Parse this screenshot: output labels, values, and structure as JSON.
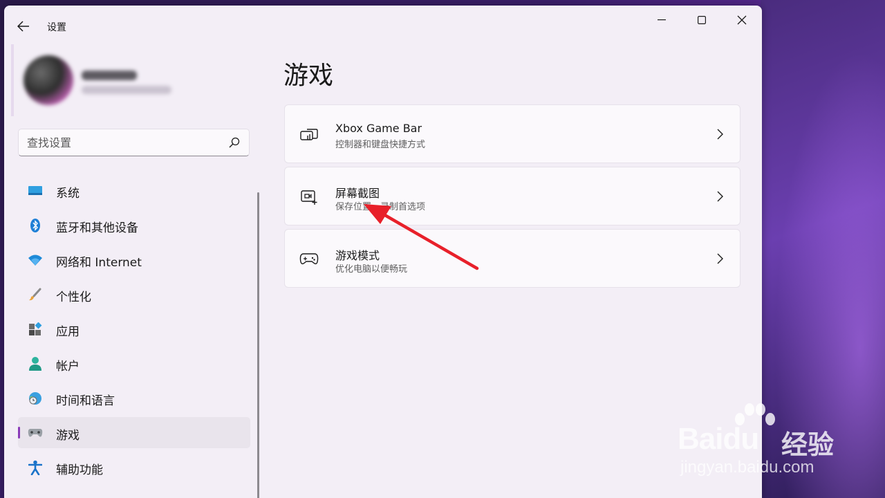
{
  "window": {
    "title": "设置"
  },
  "search": {
    "placeholder": "查找设置"
  },
  "sidebar": {
    "items": [
      {
        "label": "系统",
        "icon": "monitor-icon"
      },
      {
        "label": "蓝牙和其他设备",
        "icon": "bluetooth-icon"
      },
      {
        "label": "网络和 Internet",
        "icon": "wifi-icon"
      },
      {
        "label": "个性化",
        "icon": "brush-icon"
      },
      {
        "label": "应用",
        "icon": "apps-icon"
      },
      {
        "label": "帐户",
        "icon": "person-icon"
      },
      {
        "label": "时间和语言",
        "icon": "globe-clock-icon"
      },
      {
        "label": "游戏",
        "icon": "gamepad-icon",
        "active": true
      },
      {
        "label": "辅助功能",
        "icon": "accessibility-icon"
      }
    ]
  },
  "main": {
    "title": "游戏",
    "cards": [
      {
        "title": "Xbox Game Bar",
        "subtitle": "控制器和键盘快捷方式",
        "icon": "game-bar-icon"
      },
      {
        "title": "屏幕截图",
        "subtitle": "保存位置，录制首选项",
        "icon": "capture-icon"
      },
      {
        "title": "游戏模式",
        "subtitle": "优化电脑以便畅玩",
        "icon": "controller-icon"
      }
    ]
  },
  "watermark": {
    "logo": "Baidu",
    "cn": "经验",
    "url": "jingyan.baidu.com"
  },
  "colors": {
    "accent": "#8a3ab9",
    "annotation": "#e8202a"
  }
}
